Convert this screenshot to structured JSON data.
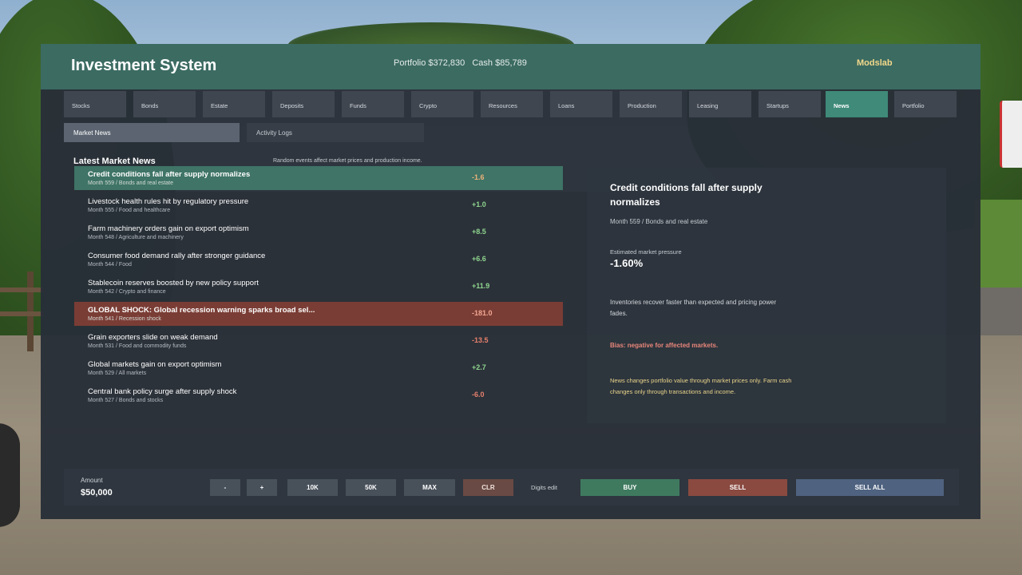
{
  "header": {
    "title": "Investment System",
    "portfolio": "Portfolio $372,830",
    "cash": "Cash $85,789",
    "brand": "Modslab"
  },
  "tabs": [
    {
      "label": "Stocks",
      "active": false
    },
    {
      "label": "Bonds",
      "active": false
    },
    {
      "label": "Estate",
      "active": false
    },
    {
      "label": "Deposits",
      "active": false
    },
    {
      "label": "Funds",
      "active": false
    },
    {
      "label": "Crypto",
      "active": false
    },
    {
      "label": "Resources",
      "active": false
    },
    {
      "label": "Loans",
      "active": false
    },
    {
      "label": "Production",
      "active": false
    },
    {
      "label": "Leasing",
      "active": false
    },
    {
      "label": "Startups",
      "active": false
    },
    {
      "label": "News",
      "active": true
    },
    {
      "label": "Portfolio",
      "active": false
    }
  ],
  "subtabs": {
    "market_news": "Market News",
    "activity_logs": "Activity Logs"
  },
  "news": {
    "heading": "Latest Market News",
    "hint": "Random events affect market prices and production income.",
    "items": [
      {
        "title": "Credit conditions fall after supply normalizes",
        "sub": "Month 559 / Bonds and real estate",
        "value": "-1.6"
      },
      {
        "title": "Livestock health rules hit by regulatory pressure",
        "sub": "Month 555 / Food and healthcare",
        "value": "+1.0"
      },
      {
        "title": "Farm machinery orders gain on export optimism",
        "sub": "Month 548 / Agriculture and machinery",
        "value": "+8.5"
      },
      {
        "title": "Consumer food demand rally after stronger guidance",
        "sub": "Month 544 / Food",
        "value": "+6.6"
      },
      {
        "title": "Stablecoin reserves boosted by new policy support",
        "sub": "Month 542 / Crypto and finance",
        "value": "+11.9"
      },
      {
        "title": "GLOBAL SHOCK: Global recession warning sparks broad sel...",
        "sub": "Month 541 / Recession shock",
        "value": "-181.0"
      },
      {
        "title": "Grain exporters slide on weak demand",
        "sub": "Month 531 / Food and commodity funds",
        "value": "-13.5"
      },
      {
        "title": "Global markets gain on export optimism",
        "sub": "Month 529 / All markets",
        "value": "+2.7"
      },
      {
        "title": "Central bank policy surge after supply shock",
        "sub": "Month 527 / Bonds and stocks",
        "value": "-6.0"
      }
    ]
  },
  "detail": {
    "title": "Credit conditions fall after supply normalizes",
    "meta": "Month 559 / Bonds and real estate",
    "pressure_label": "Estimated market pressure",
    "pressure_value": "-1.60%",
    "description": "Inventories recover faster than expected and pricing power fades.",
    "bias": "Bias: negative for affected markets.",
    "note": "News changes portfolio value through market prices only. Farm cash changes only through transactions and income."
  },
  "bottom": {
    "amount_label": "Amount",
    "amount_value": "$50,000",
    "minus": "-",
    "plus": "+",
    "k10": "10K",
    "k50": "50K",
    "max": "MAX",
    "clr": "CLR",
    "digits_edit": "Digits edit",
    "buy": "BUY",
    "sell": "SELL",
    "sell_all": "SELL ALL"
  },
  "colors": {
    "header": "#3c6b62",
    "active_tab": "#3f8a79",
    "positive": "#8fd68f",
    "negative": "#e7806c",
    "brand": "#f2d98a",
    "buy": "#3f7a5f",
    "sell": "#8a4a40",
    "sell_all": "#4f6280"
  }
}
